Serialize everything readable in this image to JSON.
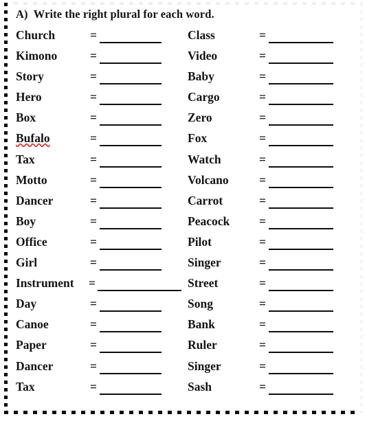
{
  "worksheet": {
    "title": "A)  Write the right plural for each word.",
    "equals_sign": "=",
    "colors": {
      "text": "#131313",
      "rule": "#0d0d0d",
      "border_dots": "#0a0a0a",
      "spellcheck_underline": "#d4332f",
      "background": "#ffffff"
    },
    "columns": {
      "left": [
        {
          "word": "Church",
          "answer": "",
          "misspelled": false
        },
        {
          "word": "Kimono",
          "answer": "",
          "misspelled": false
        },
        {
          "word": "Story",
          "answer": "",
          "misspelled": false
        },
        {
          "word": "Hero",
          "answer": "",
          "misspelled": false
        },
        {
          "word": "Box",
          "answer": "",
          "misspelled": false
        },
        {
          "word": "Bufalo",
          "answer": "",
          "misspelled": true
        },
        {
          "word": "Tax",
          "answer": "",
          "misspelled": false
        },
        {
          "word": "Motto",
          "answer": "",
          "misspelled": false
        },
        {
          "word": "Dancer",
          "answer": "",
          "misspelled": false
        },
        {
          "word": "Boy",
          "answer": "",
          "misspelled": false
        },
        {
          "word": "Office",
          "answer": "",
          "misspelled": false
        },
        {
          "word": "Girl",
          "answer": "",
          "misspelled": false
        },
        {
          "word": "Instrument",
          "answer": "",
          "misspelled": false,
          "wide": true
        },
        {
          "word": "Day",
          "answer": "",
          "misspelled": false
        },
        {
          "word": "Canoe",
          "answer": "",
          "misspelled": false
        },
        {
          "word": "Paper",
          "answer": "",
          "misspelled": false
        },
        {
          "word": "Dancer",
          "answer": "",
          "misspelled": false
        },
        {
          "word": "Tax",
          "answer": "",
          "misspelled": false
        }
      ],
      "right": [
        {
          "word": "Class",
          "answer": "",
          "misspelled": false
        },
        {
          "word": "Video",
          "answer": "",
          "misspelled": false
        },
        {
          "word": "Baby",
          "answer": "",
          "misspelled": false
        },
        {
          "word": "Cargo",
          "answer": "",
          "misspelled": false
        },
        {
          "word": "Zero",
          "answer": "",
          "misspelled": false
        },
        {
          "word": "Fox",
          "answer": "",
          "misspelled": false
        },
        {
          "word": "Watch",
          "answer": "",
          "misspelled": false
        },
        {
          "word": "Volcano",
          "answer": "",
          "misspelled": false
        },
        {
          "word": "Carrot",
          "answer": "",
          "misspelled": false
        },
        {
          "word": "Peacock",
          "answer": "",
          "misspelled": false
        },
        {
          "word": "Pilot",
          "answer": "",
          "misspelled": false
        },
        {
          "word": "Singer",
          "answer": "",
          "misspelled": false
        },
        {
          "word": "Street",
          "answer": "",
          "misspelled": false
        },
        {
          "word": "Song",
          "answer": "",
          "misspelled": false
        },
        {
          "word": "Bank",
          "answer": "",
          "misspelled": false
        },
        {
          "word": "Ruler",
          "answer": "",
          "misspelled": false
        },
        {
          "word": "Singer",
          "answer": "",
          "misspelled": false
        },
        {
          "word": "Sash",
          "answer": "",
          "misspelled": false
        }
      ]
    }
  }
}
